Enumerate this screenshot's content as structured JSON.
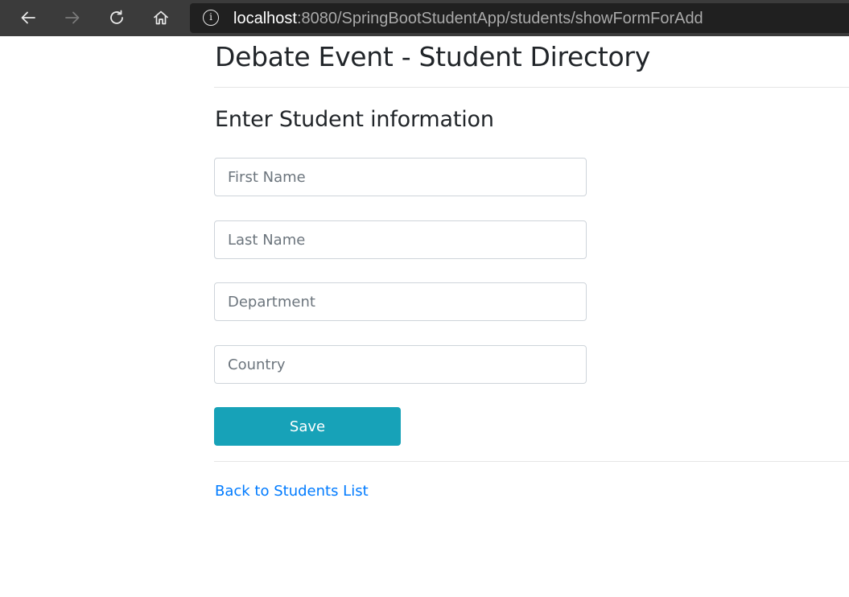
{
  "browser": {
    "url_host": "localhost",
    "url_path": ":8080/SpringBootStudentApp/students/showFormForAdd",
    "icons": [
      "back-arrow-icon",
      "forward-arrow-icon",
      "refresh-icon",
      "home-icon",
      "info-icon"
    ],
    "colors": {
      "toolbar": "#3b3b3b",
      "address_bar": "#202020"
    }
  },
  "page": {
    "title": "Debate Event - Student Directory",
    "subtitle": "Enter Student information",
    "form": {
      "first_name": {
        "placeholder": "First Name",
        "value": ""
      },
      "last_name": {
        "placeholder": "Last Name",
        "value": ""
      },
      "department": {
        "placeholder": "Department",
        "value": ""
      },
      "country": {
        "placeholder": "Country",
        "value": ""
      },
      "save_label": "Save"
    },
    "back_link": "Back to Students List",
    "colors": {
      "save_button": "#17a2b8",
      "link": "#007bff"
    }
  }
}
